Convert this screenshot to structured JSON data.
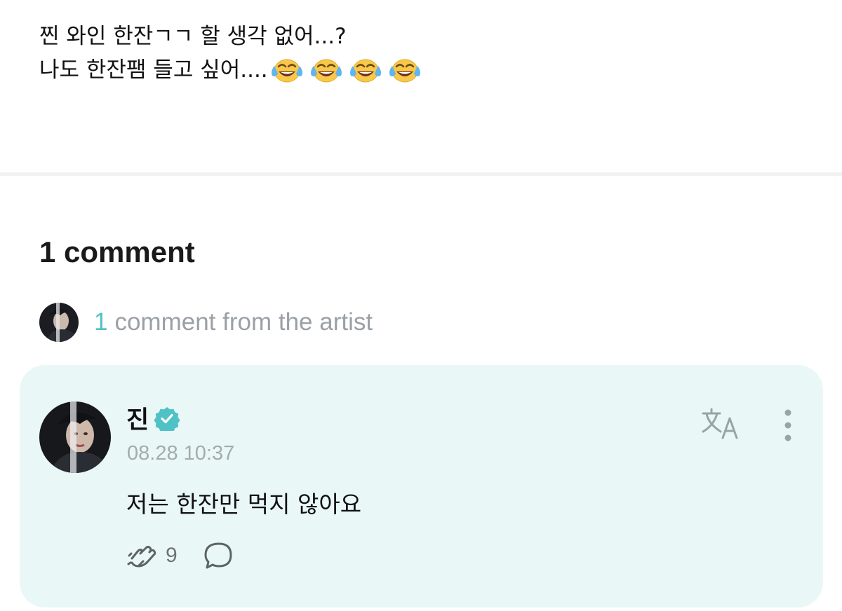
{
  "post": {
    "line1": "찐 와인 한잔ㄱㄱ 할 생각 없어...?",
    "line2": "나도 한잔팸 들고 싶어....",
    "emojis": [
      "face-with-tears-of-joy-icon",
      "face-with-tears-of-joy-icon",
      "face-with-tears-of-joy-icon",
      "face-with-tears-of-joy-icon"
    ]
  },
  "comments": {
    "heading": "1 comment",
    "artist_summary": {
      "count": "1",
      "label": "comment from the artist"
    }
  },
  "comment": {
    "author": "진",
    "verified_icon": "verified-badge-icon",
    "timestamp": "08.28 10:37",
    "text": "저는 한잔만 먹지 않아요",
    "like_count": "9",
    "icons": {
      "translate": "translate-icon",
      "more": "more-vertical-icon",
      "like": "like-clap-icon",
      "reply": "reply-bubble-icon"
    }
  },
  "colors": {
    "accent": "#4fc2c6",
    "card_background": "#e9f8f6",
    "muted_text": "#9aa0a6"
  }
}
